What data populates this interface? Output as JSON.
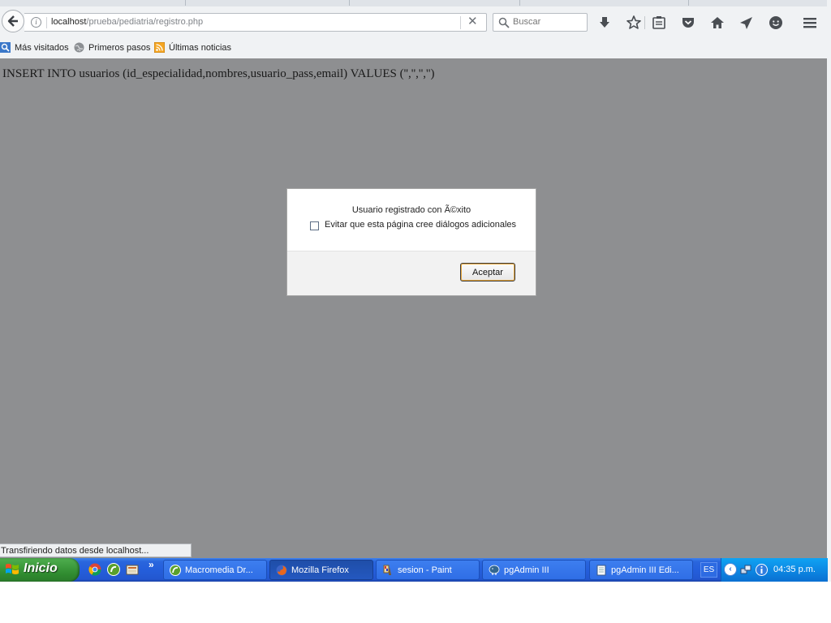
{
  "browser": {
    "url_host": "localhost",
    "url_path": "/prueba/pediatria/registro.php",
    "search_placeholder": "Buscar",
    "toolbar_icons": [
      "downloads-icon",
      "bookmark-star-icon",
      "reading-list-icon",
      "pocket-icon",
      "home-icon",
      "share-icon",
      "hello-icon",
      "menu-icon"
    ]
  },
  "bookmarks": {
    "items": [
      {
        "label": "Más visitados",
        "icon": "most-visited-icon"
      },
      {
        "label": "Primeros pasos",
        "icon": "globe-icon"
      },
      {
        "label": "Últimas noticias",
        "icon": "rss-icon"
      }
    ]
  },
  "page": {
    "sql_text": "INSERT INTO usuarios (id_especialidad,nombres,usuario_pass,email) VALUES ('','','','')"
  },
  "dialog": {
    "message": "Usuario registrado con Ã©xito",
    "checkbox_label": "Evitar que esta página cree diálogos adicionales",
    "checkbox_checked": false,
    "ok_label": "Aceptar"
  },
  "status": {
    "text": "Transfiriendo datos desde localhost..."
  },
  "taskbar": {
    "start_label": "Inicio",
    "more_label": "»",
    "tasks": [
      {
        "label": "Macromedia Dr...",
        "active": false
      },
      {
        "label": "Mozilla Firefox",
        "active": true
      },
      {
        "label": "sesion - Paint",
        "active": false
      },
      {
        "label": "pgAdmin III",
        "active": false
      },
      {
        "label": "pgAdmin III Edi...",
        "active": false
      }
    ],
    "language": "ES",
    "chevron": "‹",
    "clock": "04:35 p.m."
  },
  "colors": {
    "page_background": "#8e8f91",
    "taskbar_blue": "#245edb",
    "start_green": "#3c9a3c",
    "tray_blue": "#0c89e4",
    "ok_focus_ring": "#e8a73a"
  }
}
